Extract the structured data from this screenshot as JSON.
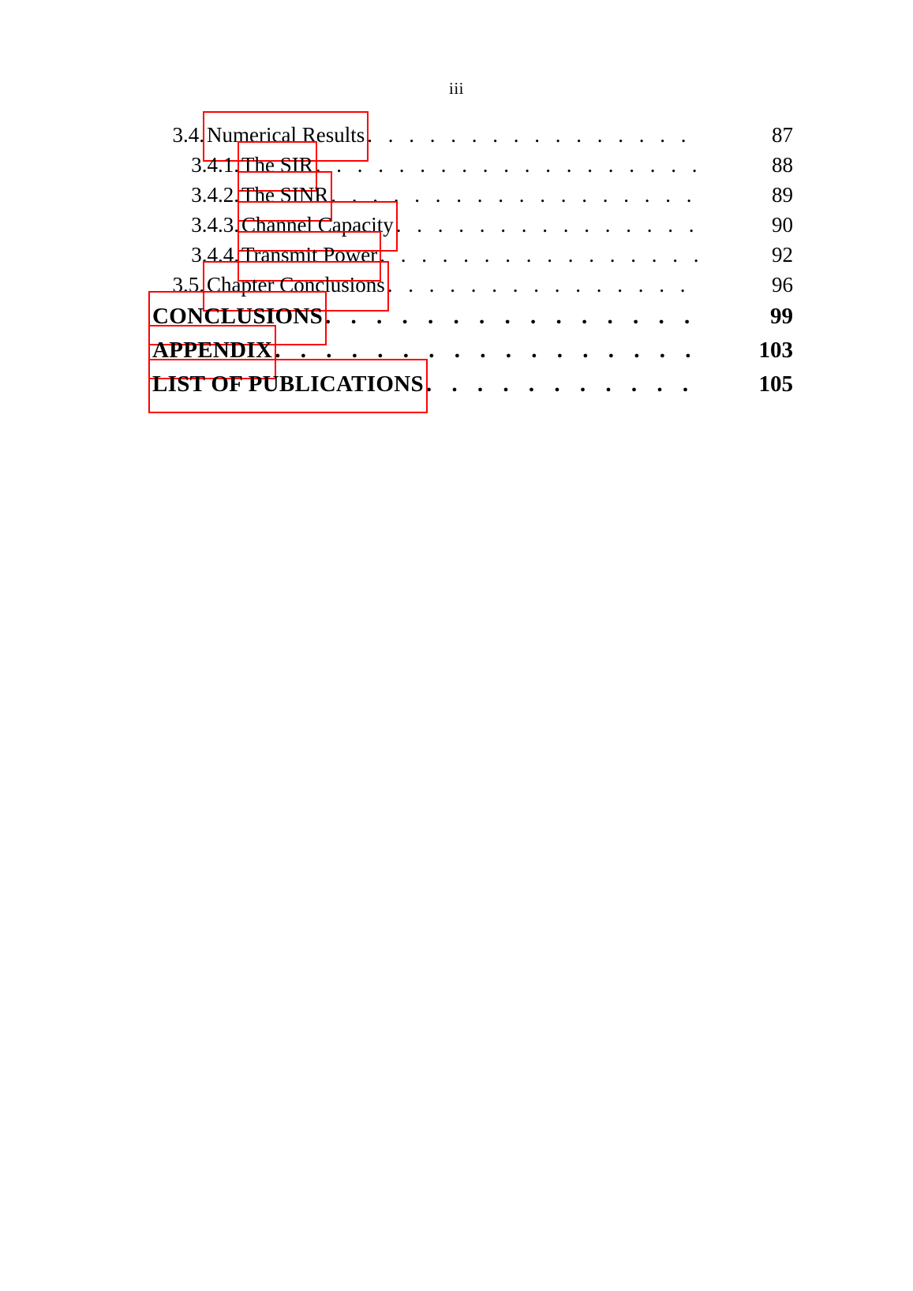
{
  "document": {
    "folio": "iii",
    "highlight_color": "#ff0000",
    "leader_dots": ". . . . . . . . . . . . . . . . . . . . . . . . . . . . . . . . . . . . . . . . . . . . . . . . . . . . . . . . . . . . . . . . ."
  },
  "toc": {
    "entries": [
      {
        "number": "3.4.",
        "title": "Numerical Results",
        "page": "87",
        "level": 2,
        "highlighted": true
      },
      {
        "number": "3.4.1.",
        "title": "The SIR",
        "page": "88",
        "level": 3,
        "highlighted": true
      },
      {
        "number": "3.4.2.",
        "title": "The SINR",
        "page": "89",
        "level": 3,
        "highlighted": true
      },
      {
        "number": "3.4.3.",
        "title": "Channel Capacity",
        "page": "90",
        "level": 3,
        "highlighted": true
      },
      {
        "number": "3.4.4.",
        "title": "Transmit Power",
        "page": "92",
        "level": 3,
        "highlighted": true
      },
      {
        "number": "3.5.",
        "title": "Chapter Conclusions",
        "page": "96",
        "level": 2,
        "highlighted": true
      },
      {
        "number": "",
        "title": "CONCLUSIONS",
        "page": "99",
        "level": 1,
        "highlighted": true
      },
      {
        "number": "",
        "title": "APPENDIX",
        "page": "103",
        "level": 1,
        "highlighted": true
      },
      {
        "number": "",
        "title": "LIST OF PUBLICATIONS",
        "page": "105",
        "level": 1,
        "highlighted": true
      }
    ]
  }
}
